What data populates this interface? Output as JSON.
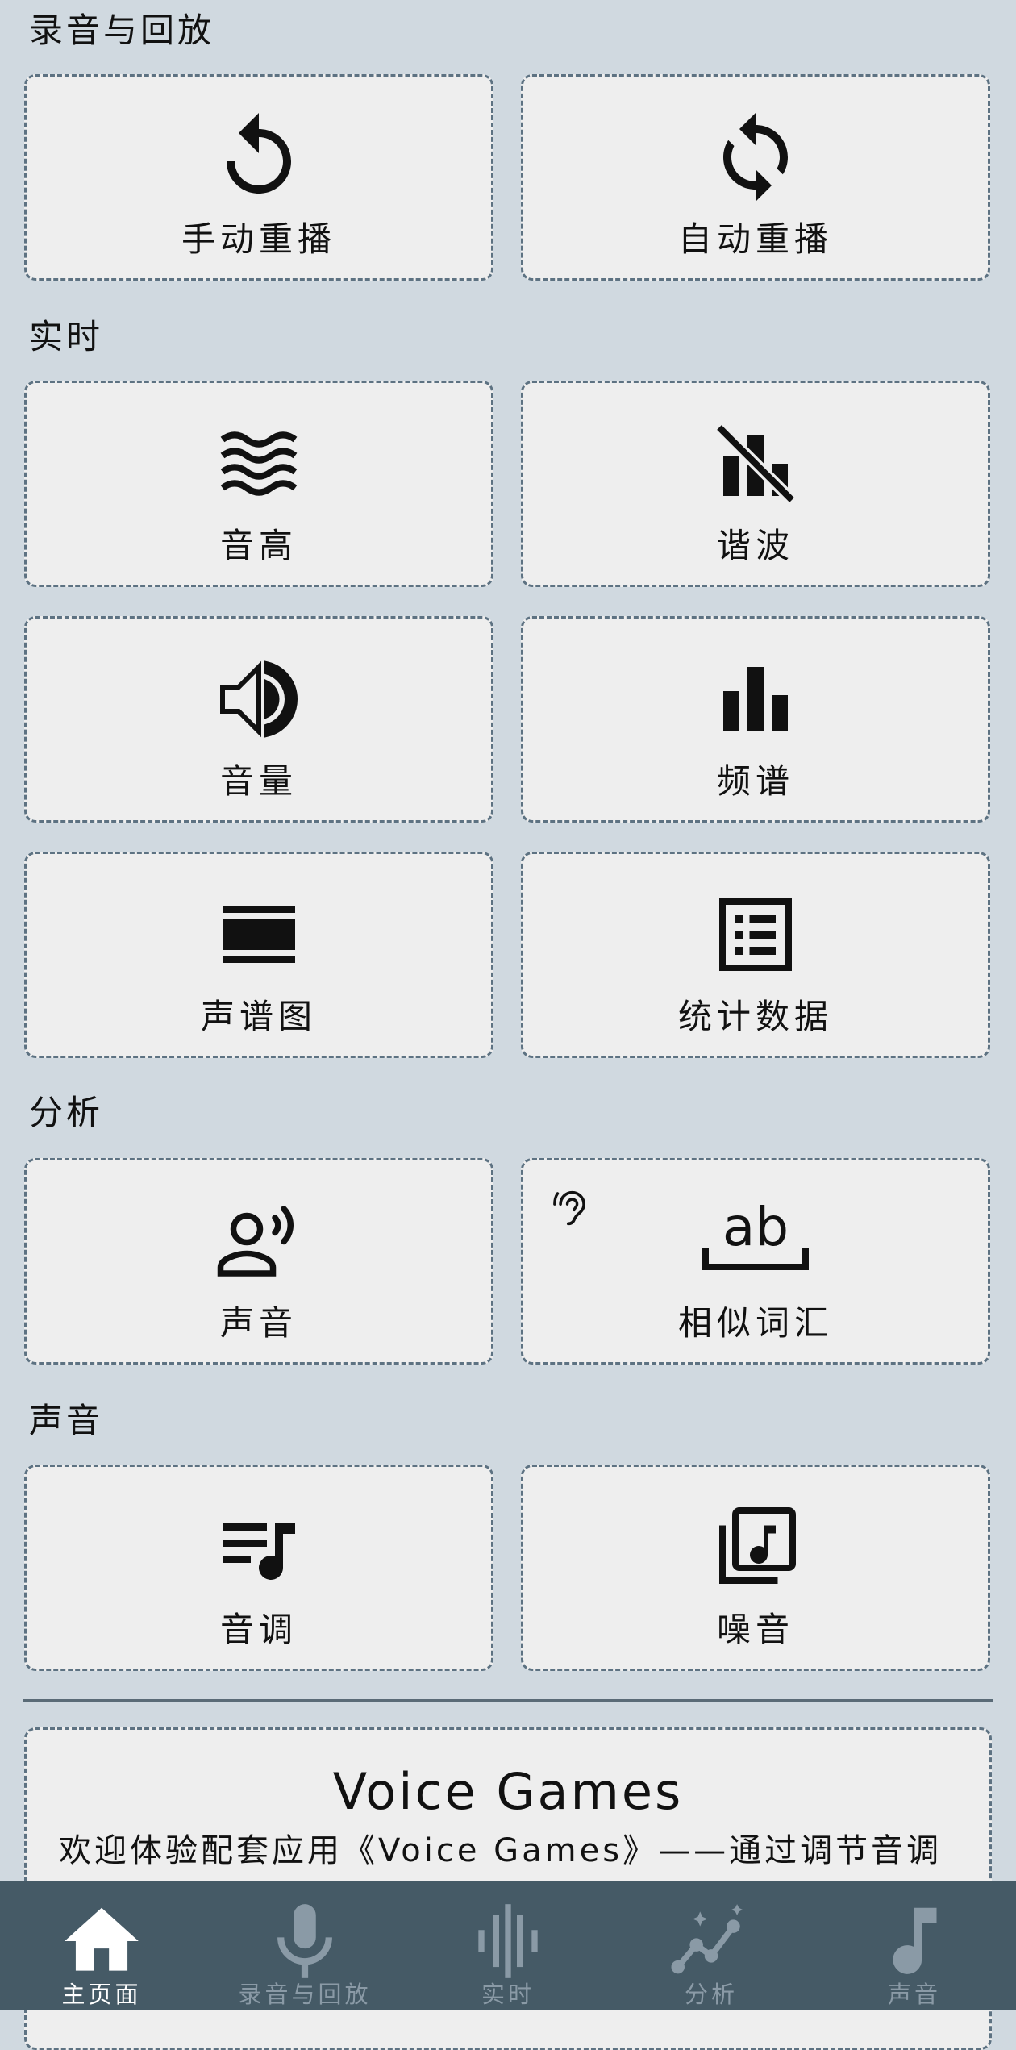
{
  "sections": {
    "recording": "录音与回放",
    "realtime": "实时",
    "analysis": "分析",
    "sound": "声音"
  },
  "cards": {
    "manual_replay": "手动重播",
    "auto_replay": "自动重播",
    "pitch": "音高",
    "harmonics": "谐波",
    "volume": "音量",
    "spectrum": "频谱",
    "spectrogram": "声谱图",
    "statistics": "统计数据",
    "voice": "声音",
    "similar_words": "相似词汇",
    "similar_words_tag": "ab",
    "tone": "音调",
    "noise": "噪音"
  },
  "promo": {
    "title": "Voice Games",
    "text": "欢迎体验配套应用《Voice Games》——通过调节音调来玩游戏吧！"
  },
  "nav": [
    {
      "label": "主页面",
      "icon": "home-icon",
      "active": true
    },
    {
      "label": "录音与回放",
      "icon": "mic-icon",
      "active": false
    },
    {
      "label": "实时",
      "icon": "waveform-icon",
      "active": false
    },
    {
      "label": "分析",
      "icon": "analytics-icon",
      "active": false
    },
    {
      "label": "声音",
      "icon": "music-note-icon",
      "active": false
    }
  ],
  "colors": {
    "background": "#d0d9e0",
    "card": "#eeeeee",
    "card_border": "#5d7282",
    "navbar": "#455a66",
    "nav_active": "#ffffff",
    "nav_inactive": "#8a9aa6"
  }
}
